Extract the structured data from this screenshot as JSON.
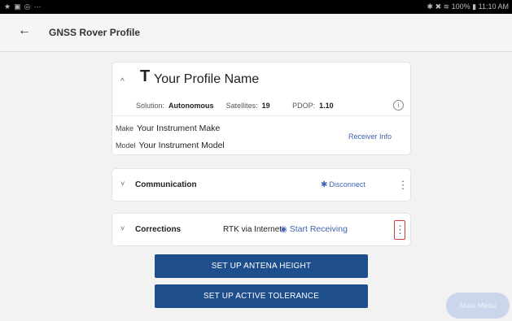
{
  "status_bar": {
    "left_icons": [
      "★",
      "▣",
      "◎",
      "···"
    ],
    "right_text": "✱ ✖ ≋ 100% ▮ 11:10 AM"
  },
  "header": {
    "back_icon": "←",
    "title": "GNSS Rover Profile"
  },
  "profile_card": {
    "expand_icon": "^",
    "profile_icon": "T",
    "profile_name": "Your Profile Name",
    "solution_label": "Solution:",
    "solution_value": "Autonomous",
    "satellites_label": "Satellites:",
    "satellites_value": "19",
    "pdop_label": "PDOP:",
    "pdop_value": "1.10",
    "info_icon": "i",
    "make_label": "Make",
    "make_value": "Your Instrument Make",
    "model_label": "Model",
    "model_value": "Your Instrument Model",
    "receiver_info": "Receiver Info"
  },
  "communication_card": {
    "chevron": "˅",
    "title": "Communication",
    "bluetooth_icon": "✱",
    "action": "Disconnect",
    "menu_icon": "⋮"
  },
  "corrections_card": {
    "chevron": "˅",
    "title": "Corrections",
    "method": "RTK via Internet",
    "antenna_icon": "◉",
    "action": "Start Receiving",
    "menu_icon": "⋮"
  },
  "buttons": {
    "antenna_height": "SET UP ANTENA HEIGHT",
    "active_tolerance": "SET UP ACTIVE TOLERANCE"
  },
  "fab": {
    "label": "Main Menu"
  },
  "colors": {
    "primary_button": "#1f4e8c",
    "link": "#3f63b0",
    "highlight_box": "#d13a3a"
  }
}
